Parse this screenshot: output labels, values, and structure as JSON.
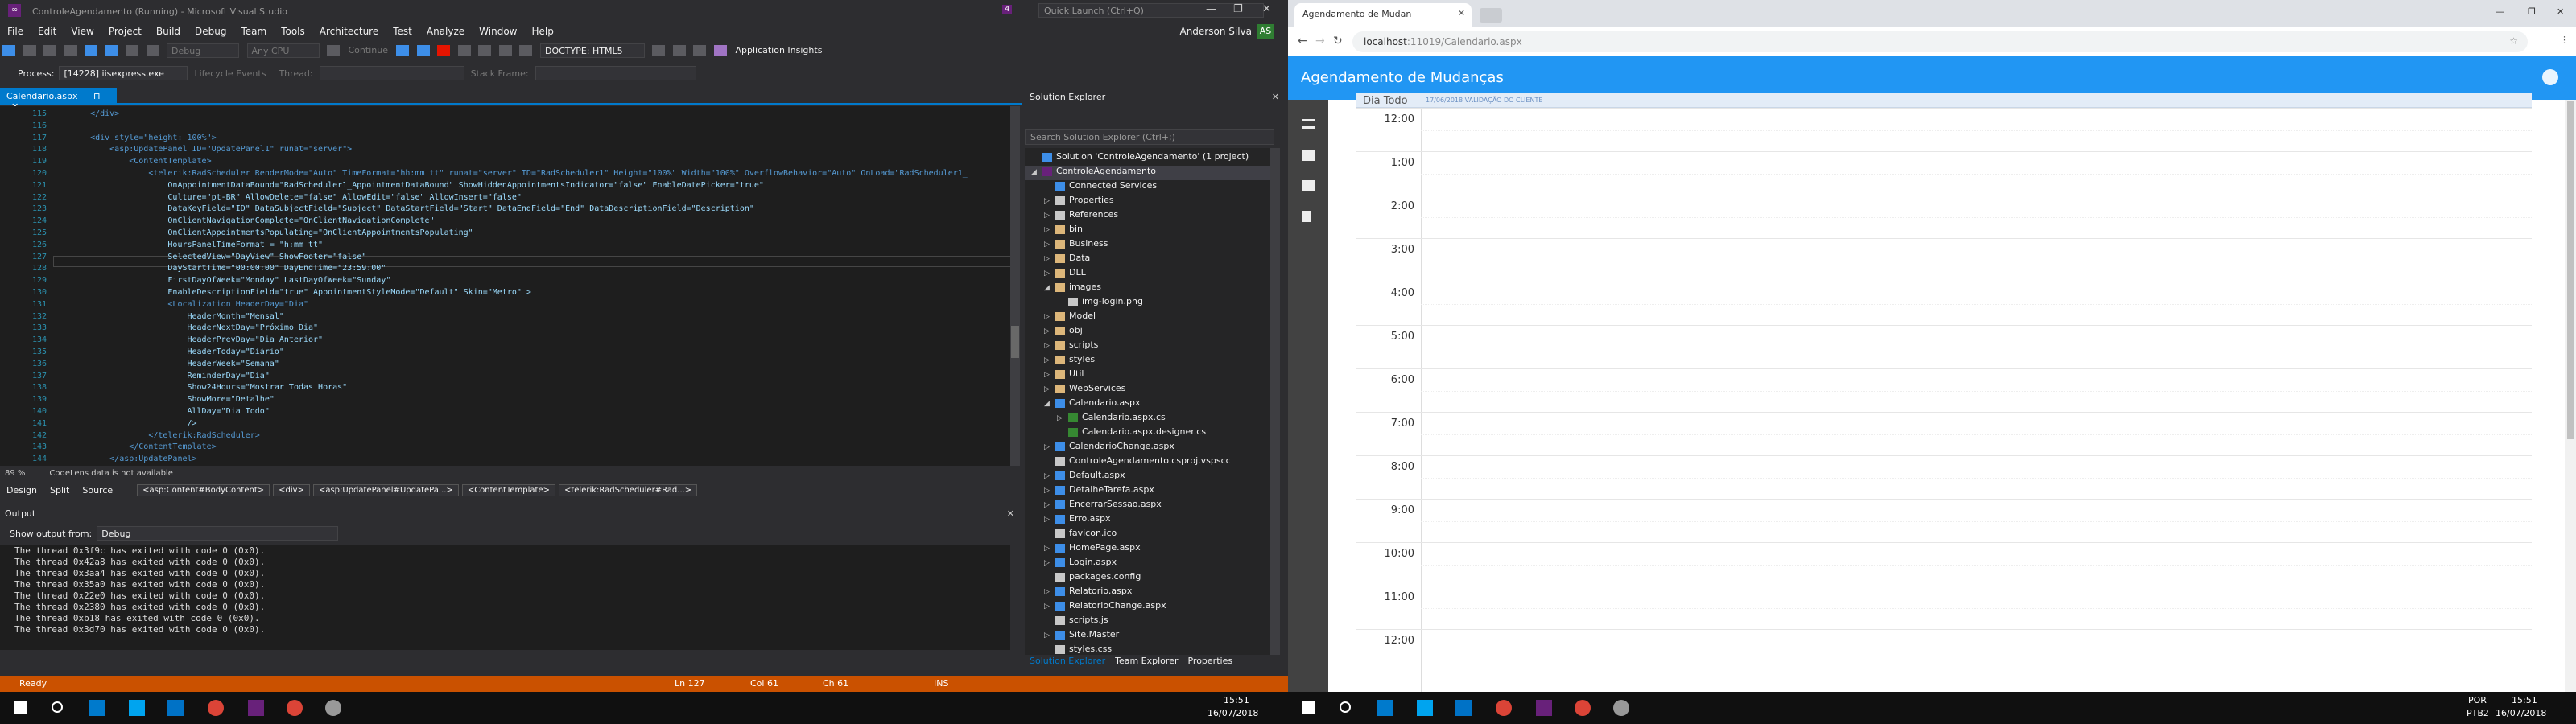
{
  "vs": {
    "title": "ControleAgendamento (Running) - Microsoft Visual Studio",
    "notification_count": "4",
    "quick_launch": "Quick Launch (Ctrl+Q)",
    "menu": [
      "File",
      "Edit",
      "View",
      "Project",
      "Build",
      "Debug",
      "Team",
      "Tools",
      "Architecture",
      "Test",
      "Analyze",
      "Window",
      "Help"
    ],
    "user": "Anderson Silva",
    "user_initials": "AS",
    "toolbar": {
      "config": "Debug",
      "platform": "Any CPU",
      "continue": "Continue",
      "doctype": "DOCTYPE: HTML5",
      "app_insights": "Application Insights"
    },
    "process_label": "Process:",
    "process_value": "[14228] iisexpress.exe",
    "lifecycle": "Lifecycle Events",
    "thread": "Thread:",
    "stack_frame": "Stack Frame:",
    "tab_name": "Calendario.aspx",
    "code_lines": [
      {
        "n": "115",
        "t": "    </div>"
      },
      {
        "n": "116",
        "t": ""
      },
      {
        "n": "117",
        "t": "    <div style=\"height: 100%\">"
      },
      {
        "n": "118",
        "t": "        <asp:UpdatePanel ID=\"UpdatePanel1\" runat=\"server\">"
      },
      {
        "n": "119",
        "t": "            <ContentTemplate>"
      },
      {
        "n": "120",
        "t": "                <telerik:RadScheduler RenderMode=\"Auto\" TimeFormat=\"hh:mm tt\" runat=\"server\" ID=\"RadScheduler1\" Height=\"100%\" Width=\"100%\" OverflowBehavior=\"Auto\" OnLoad=\"RadScheduler1_"
      },
      {
        "n": "121",
        "t": "                    OnAppointmentDataBound=\"RadScheduler1_AppointmentDataBound\" ShowHiddenAppointmentsIndicator=\"false\" EnableDatePicker=\"true\""
      },
      {
        "n": "122",
        "t": "                    Culture=\"pt-BR\" AllowDelete=\"false\" AllowEdit=\"false\" AllowInsert=\"false\""
      },
      {
        "n": "123",
        "t": "                    DataKeyField=\"ID\" DataSubjectField=\"Subject\" DataStartField=\"Start\" DataEndField=\"End\" DataDescriptionField=\"Description\""
      },
      {
        "n": "124",
        "t": "                    OnClientNavigationComplete=\"OnClientNavigationComplete\""
      },
      {
        "n": "125",
        "t": "                    OnClientAppointmentsPopulating=\"OnClientAppointmentsPopulating\""
      },
      {
        "n": "126",
        "t": "                    HoursPanelTimeFormat = \"h:mm tt\""
      },
      {
        "n": "127",
        "t": "                    SelectedView=\"DayView\" ShowFooter=\"false\""
      },
      {
        "n": "128",
        "t": "                    DayStartTime=\"00:00:00\" DayEndTime=\"23:59:00\""
      },
      {
        "n": "129",
        "t": "                    FirstDayOfWeek=\"Monday\" LastDayOfWeek=\"Sunday\""
      },
      {
        "n": "130",
        "t": "                    EnableDescriptionField=\"true\" AppointmentStyleMode=\"Default\" Skin=\"Metro\" >"
      },
      {
        "n": "131",
        "t": "                    <Localization HeaderDay=\"Dia\""
      },
      {
        "n": "132",
        "t": "                        HeaderMonth=\"Mensal\""
      },
      {
        "n": "133",
        "t": "                        HeaderNextDay=\"Próximo Dia\""
      },
      {
        "n": "134",
        "t": "                        HeaderPrevDay=\"Dia Anterior\""
      },
      {
        "n": "135",
        "t": "                        HeaderToday=\"Diário\""
      },
      {
        "n": "136",
        "t": "                        HeaderWeek=\"Semana\""
      },
      {
        "n": "137",
        "t": "                        ReminderDay=\"Dia\""
      },
      {
        "n": "138",
        "t": "                        Show24Hours=\"Mostrar Todas Horas\""
      },
      {
        "n": "139",
        "t": "                        ShowMore=\"Detalhe\""
      },
      {
        "n": "140",
        "t": "                        AllDay=\"Dia Todo\""
      },
      {
        "n": "141",
        "t": "                        />"
      },
      {
        "n": "142",
        "t": "                </telerik:RadScheduler>"
      },
      {
        "n": "143",
        "t": "            </ContentTemplate>"
      },
      {
        "n": "144",
        "t": "        </asp:UpdatePanel>"
      }
    ],
    "zoom": "89 %",
    "codelens_msg": "CodeLens data is not available",
    "view_modes": [
      "Design",
      "Split",
      "Source"
    ],
    "crumbs": [
      "<asp:Content#BodyContent>",
      "<div>",
      "<asp:UpdatePanel#UpdatePa...>",
      "<ContentTemplate>",
      "<telerik:RadScheduler#Rad...>"
    ],
    "output_title": "Output",
    "show_output_from": "Show output from:",
    "output_source": "Debug",
    "output_lines": [
      "The thread 0x3f9c has exited with code 0 (0x0).",
      "The thread 0x42a8 has exited with code 0 (0x0).",
      "The thread 0x3aa4 has exited with code 0 (0x0).",
      "The thread 0x35a0 has exited with code 0 (0x0).",
      "The thread 0x22e0 has exited with code 0 (0x0).",
      "The thread 0x2380 has exited with code 0 (0x0).",
      "The thread 0xb18 has exited with code 0 (0x0).",
      "The thread 0x3d70 has exited with code 0 (0x0)."
    ],
    "solution_explorer": {
      "title": "Solution Explorer",
      "search": "Search Solution Explorer (Ctrl+;)",
      "tree": [
        {
          "d": 0,
          "i": "web",
          "a": "",
          "l": "Solution 'ControleAgendamento' (1 project)"
        },
        {
          "d": 0,
          "i": "proj",
          "a": "◢",
          "l": "ControleAgendamento",
          "sel": true
        },
        {
          "d": 1,
          "i": "web",
          "a": "",
          "l": "Connected Services"
        },
        {
          "d": 1,
          "i": "file",
          "a": "▷",
          "l": "Properties"
        },
        {
          "d": 1,
          "i": "file",
          "a": "▷",
          "l": "References"
        },
        {
          "d": 1,
          "i": "fold",
          "a": "▷",
          "l": "bin"
        },
        {
          "d": 1,
          "i": "fold",
          "a": "▷",
          "l": "Business"
        },
        {
          "d": 1,
          "i": "fold",
          "a": "▷",
          "l": "Data"
        },
        {
          "d": 1,
          "i": "fold",
          "a": "▷",
          "l": "DLL"
        },
        {
          "d": 1,
          "i": "fold",
          "a": "◢",
          "l": "images"
        },
        {
          "d": 2,
          "i": "file",
          "a": "",
          "l": "img-login.png"
        },
        {
          "d": 1,
          "i": "fold",
          "a": "▷",
          "l": "Model"
        },
        {
          "d": 1,
          "i": "fold",
          "a": "▷",
          "l": "obj"
        },
        {
          "d": 1,
          "i": "fold",
          "a": "▷",
          "l": "scripts"
        },
        {
          "d": 1,
          "i": "fold",
          "a": "▷",
          "l": "styles"
        },
        {
          "d": 1,
          "i": "fold",
          "a": "▷",
          "l": "Util"
        },
        {
          "d": 1,
          "i": "fold",
          "a": "▷",
          "l": "WebServices"
        },
        {
          "d": 1,
          "i": "web",
          "a": "◢",
          "l": "Calendario.aspx"
        },
        {
          "d": 2,
          "i": "cs",
          "a": "▷",
          "l": "Calendario.aspx.cs"
        },
        {
          "d": 2,
          "i": "cs",
          "a": "",
          "l": "Calendario.aspx.designer.cs"
        },
        {
          "d": 1,
          "i": "web",
          "a": "▷",
          "l": "CalendarioChange.aspx"
        },
        {
          "d": 1,
          "i": "file",
          "a": "",
          "l": "ControleAgendamento.csproj.vspscc"
        },
        {
          "d": 1,
          "i": "web",
          "a": "▷",
          "l": "Default.aspx"
        },
        {
          "d": 1,
          "i": "web",
          "a": "▷",
          "l": "DetalheTarefa.aspx"
        },
        {
          "d": 1,
          "i": "web",
          "a": "▷",
          "l": "EncerrarSessao.aspx"
        },
        {
          "d": 1,
          "i": "web",
          "a": "▷",
          "l": "Erro.aspx"
        },
        {
          "d": 1,
          "i": "file",
          "a": "",
          "l": "favicon.ico"
        },
        {
          "d": 1,
          "i": "web",
          "a": "▷",
          "l": "HomePage.aspx"
        },
        {
          "d": 1,
          "i": "web",
          "a": "▷",
          "l": "Login.aspx"
        },
        {
          "d": 1,
          "i": "file",
          "a": "",
          "l": "packages.config"
        },
        {
          "d": 1,
          "i": "web",
          "a": "▷",
          "l": "Relatorio.aspx"
        },
        {
          "d": 1,
          "i": "web",
          "a": "▷",
          "l": "RelatorioChange.aspx"
        },
        {
          "d": 1,
          "i": "file",
          "a": "",
          "l": "scripts.js"
        },
        {
          "d": 1,
          "i": "web",
          "a": "▷",
          "l": "Site.Master"
        },
        {
          "d": 1,
          "i": "file",
          "a": "",
          "l": "styles.css"
        }
      ],
      "tabs": [
        "Solution Explorer",
        "Team Explorer",
        "Properties"
      ]
    },
    "status": {
      "ready": "Ready",
      "ln": "Ln 127",
      "col": "Col 61",
      "ch": "Ch 61",
      "ins": "INS"
    }
  },
  "taskbar": {
    "lang": "POR",
    "layout": "PTB2",
    "time": "15:51",
    "date": "16/07/2018"
  },
  "browser": {
    "tab_title": "Agendamento de Mudan",
    "url_host": "localhost",
    "url_rest": ":11019/Calendario.aspx",
    "app_title": "Agendamento de Mudanças",
    "allday_label": "Dia Todo",
    "appointment_label": "17/06/2018 VALIDAÇÃO DO CLIENTE",
    "hours": [
      "12:00",
      "1:00",
      "2:00",
      "3:00",
      "4:00",
      "5:00",
      "6:00",
      "7:00",
      "8:00",
      "9:00",
      "10:00",
      "11:00",
      "12:00"
    ]
  },
  "colors": {
    "vs_accent": "#007acc",
    "vs_status": "#ca5100",
    "app_header": "#2196f3"
  }
}
